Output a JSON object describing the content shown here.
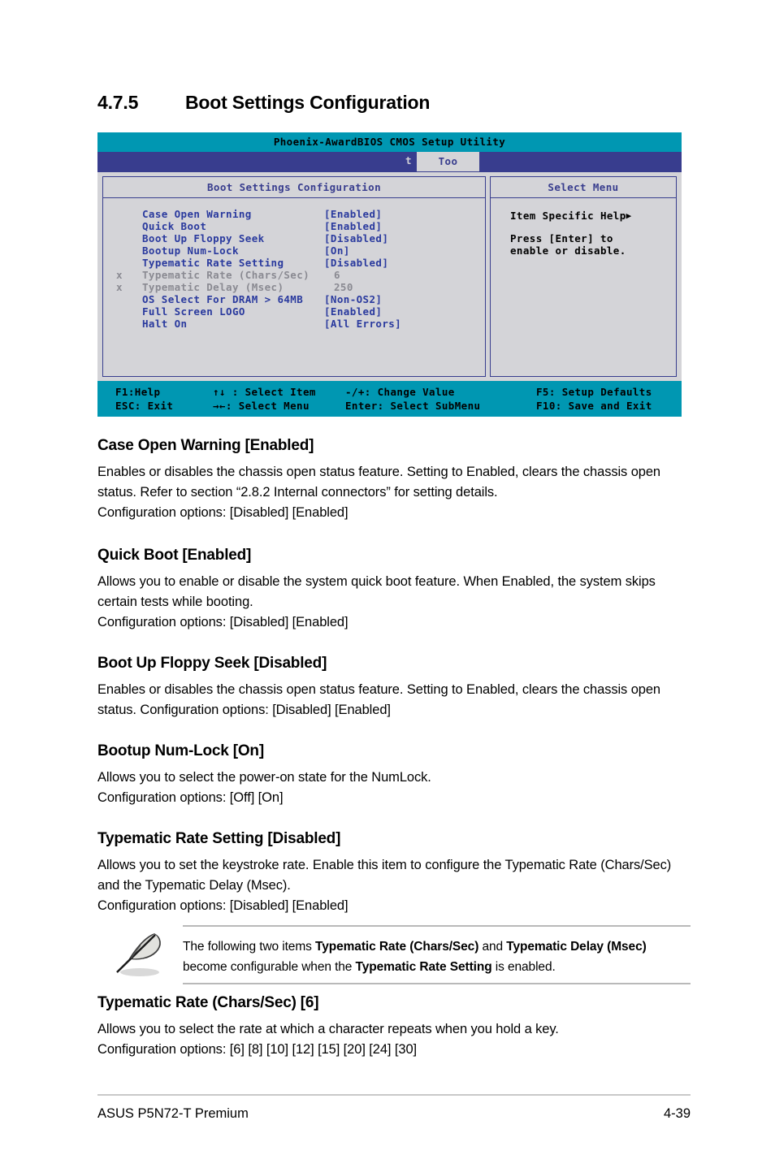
{
  "section": {
    "number": "4.7.5",
    "title": "Boot Settings Configuration"
  },
  "bios": {
    "title": "Phoenix-AwardBIOS CMOS Setup Utility",
    "menubar": {
      "ghost_letter": "t",
      "visible_tab": "Too"
    },
    "left_panel": {
      "header": "Boot Settings Configuration",
      "items": [
        {
          "mark": "",
          "label": "Case Open Warning",
          "value": "[Enabled]",
          "dim": false
        },
        {
          "mark": "",
          "label": "Quick Boot",
          "value": "[Enabled]",
          "dim": false
        },
        {
          "mark": "",
          "label": "Boot Up Floppy Seek",
          "value": "[Disabled]",
          "dim": false
        },
        {
          "mark": "",
          "label": "Bootup Num-Lock",
          "value": "[On]",
          "dim": false
        },
        {
          "mark": "",
          "label": "Typematic Rate Setting",
          "value": "[Disabled]",
          "dim": false
        },
        {
          "mark": "x",
          "label": "Typematic Rate (Chars/Sec)",
          "value": "6",
          "dim": true
        },
        {
          "mark": "x",
          "label": "Typematic Delay (Msec)",
          "value": "250",
          "dim": true
        },
        {
          "mark": "",
          "label": "OS Select For DRAM > 64MB",
          "value": "[Non-OS2]",
          "dim": false
        },
        {
          "mark": "",
          "label": "Full Screen LOGO",
          "value": "[Enabled]",
          "dim": false
        },
        {
          "mark": "",
          "label": "Halt On",
          "value": "[All Errors]",
          "dim": false
        }
      ]
    },
    "right_panel": {
      "header": "Select Menu",
      "help_title": "Item Specific Help",
      "help_arrow": "▶",
      "help_text": "Press [Enter] to\nenable or disable."
    },
    "footer": {
      "f1_help": "F1:Help",
      "esc_exit": "ESC: Exit",
      "select_item": "↑↓ : Select Item",
      "select_menu": "→←: Select Menu",
      "change_value": "-/+: Change Value",
      "select_submenu": "Enter: Select SubMenu",
      "setup_defaults": "F5: Setup Defaults",
      "save_exit": "F10: Save and Exit"
    },
    "colors": {
      "titlebar": "#0097b2",
      "menubar": "#383d8e",
      "panel_bg": "#d4d4d8",
      "panel_border": "#383d8e",
      "option_text": "#2a3a9e",
      "option_dim": "#8a8a92"
    }
  },
  "blocks": [
    {
      "title": "Case Open Warning [Enabled]",
      "paragraphs": [
        "Enables or disables the chassis open status feature. Setting to Enabled, clears the chassis open status. Refer to section “2.8.2 Internal connectors” for setting details.",
        "Configuration options: [Disabled] [Enabled]"
      ]
    },
    {
      "title": "Quick Boot [Enabled]",
      "paragraphs": [
        "Allows you to enable or disable the system quick boot feature. When Enabled, the system skips certain tests while booting.",
        "Configuration options: [Disabled] [Enabled]"
      ]
    },
    {
      "title": "Boot Up Floppy Seek [Disabled]",
      "paragraphs": [
        "Enables or disables the chassis open status feature. Setting to Enabled, clears the chassis open status. Configuration options: [Disabled] [Enabled]"
      ]
    },
    {
      "title": "Bootup Num-Lock [On]",
      "paragraphs": [
        "Allows you to select the power-on state for the NumLock.",
        "Configuration options: [Off] [On]"
      ]
    },
    {
      "title": "Typematic Rate Setting [Disabled]",
      "paragraphs": [
        "Allows you to set the keystroke rate. Enable this item to configure the Typematic Rate (Chars/Sec) and the Typematic Delay (Msec).",
        "Configuration options: [Disabled] [Enabled]"
      ]
    },
    {
      "title": "Typematic Rate (Chars/Sec) [6]",
      "paragraphs": [
        "Allows you to select the rate at which a character repeats when you hold a key.",
        "Configuration options: [6] [8] [10] [12] [15] [20] [24] [30]"
      ]
    }
  ],
  "note": {
    "icon": "feather-pen-icon",
    "segments": [
      {
        "text": "The following two items ",
        "bold": false
      },
      {
        "text": "Typematic Rate (Chars/Sec)",
        "bold": true
      },
      {
        "text": " and ",
        "bold": false
      },
      {
        "text": "Typematic Delay (Msec)",
        "bold": true
      },
      {
        "text": " become configurable when the ",
        "bold": false
      },
      {
        "text": "Typematic Rate Setting",
        "bold": true
      },
      {
        "text": " is enabled.",
        "bold": false
      }
    ]
  },
  "page_footer": {
    "left": "ASUS P5N72-T Premium",
    "right": "4-39"
  }
}
